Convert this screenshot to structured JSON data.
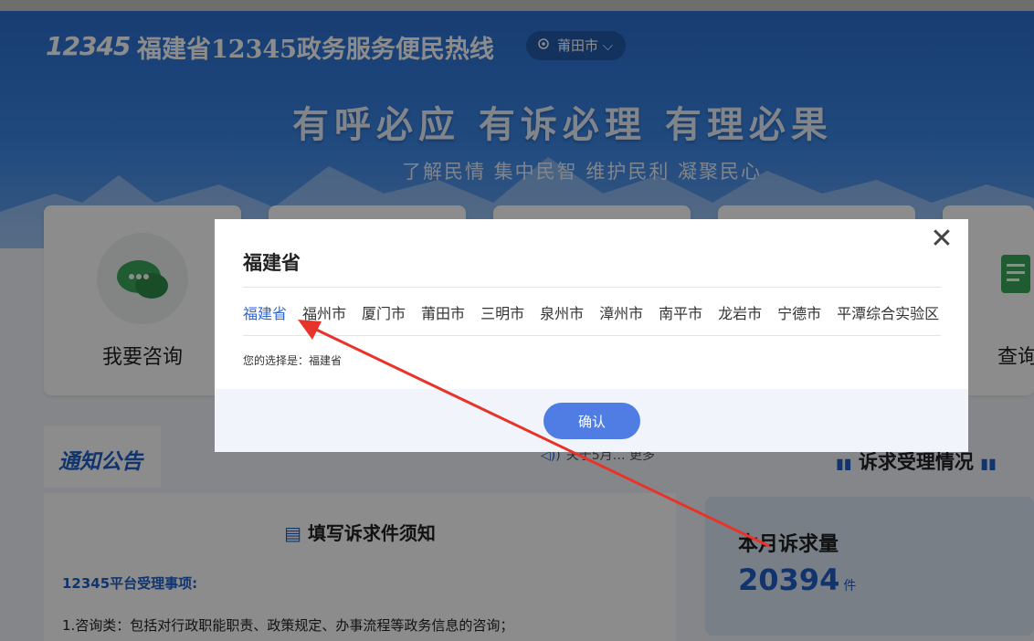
{
  "header": {
    "logo_text": "12345",
    "site_title": "福建省12345政务服务便民热线",
    "current_city": "莆田市"
  },
  "banner": {
    "slogan_main": "有呼必应  有诉必理  有理必果",
    "slogan_sub": "了解民情 集中民智 维护民利 凝聚民心"
  },
  "cards": [
    {
      "label": "我要咨询",
      "icon": "wechat-bubble-icon"
    },
    {
      "label": "查询",
      "icon": "document-icon"
    }
  ],
  "notice": {
    "tab_label": "通知公告",
    "ticker_text": "关于5月…  更多",
    "stats_title": "诉求受理情况"
  },
  "panel": {
    "title": "填写诉求件须知",
    "subtitle": "12345平台受理事项:",
    "line1": "1.咨询类：包括对行政职能职责、政策规定、办事流程等政务信息的咨询；"
  },
  "stats": {
    "label": "本月诉求量",
    "value": "20394",
    "unit": "件"
  },
  "modal": {
    "title": "福建省",
    "cities": [
      "福建省",
      "福州市",
      "厦门市",
      "莆田市",
      "三明市",
      "泉州市",
      "漳州市",
      "南平市",
      "龙岩市",
      "宁德市",
      "平潭综合实验区"
    ],
    "selected_index": 0,
    "choice_prefix": "您的选择是：",
    "choice_value": "福建省",
    "confirm_label": "确认",
    "close_icon": "close-icon"
  },
  "colors": {
    "accent": "#2f67d5",
    "button": "#4f7de4",
    "annotation_arrow": "#e8332b"
  }
}
